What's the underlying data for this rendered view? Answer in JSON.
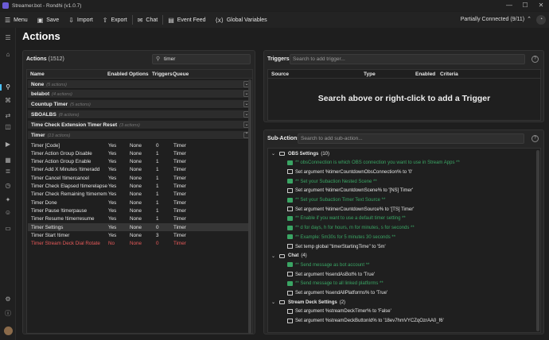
{
  "window": {
    "title": "Streamer.bot - Rondhi (v1.0.7)",
    "minimize": "—",
    "maximize": "☐",
    "close": "✕"
  },
  "menu": {
    "items": [
      {
        "label": "Menu",
        "icon": "hamburger-icon",
        "glyph": "☰"
      },
      {
        "label": "Save",
        "icon": "save-icon",
        "glyph": "▣"
      },
      {
        "label": "Import",
        "icon": "import-icon",
        "glyph": "⇩"
      },
      {
        "label": "Export",
        "icon": "export-icon",
        "glyph": "⇧"
      },
      {
        "label": "Chat",
        "icon": "chat-icon",
        "glyph": "✉"
      },
      {
        "label": "Event Feed",
        "icon": "feed-icon",
        "glyph": "▤"
      },
      {
        "label": "Global Variables",
        "icon": "variables-icon",
        "glyph": "⟨x⟩"
      }
    ],
    "connection": "Partially Connected (9/11)",
    "connection_glyph": "⌃",
    "user_glyph": "◔"
  },
  "rail": {
    "items": [
      {
        "icon": "hamburger-icon",
        "glyph": "☰"
      },
      {
        "icon": "home-icon",
        "glyph": "⌂"
      },
      {
        "icon": "actions-icon",
        "glyph": "⚲",
        "active": true
      },
      {
        "icon": "commands-icon",
        "glyph": "⌘"
      },
      {
        "icon": "servers-icon",
        "glyph": "⇄"
      },
      {
        "icon": "integrations-icon",
        "glyph": "◫"
      },
      {
        "icon": "platform-icon",
        "glyph": "▶"
      },
      {
        "icon": "streamdeck-icon",
        "glyph": "▦"
      },
      {
        "icon": "queue-icon",
        "glyph": "≣"
      },
      {
        "icon": "timers-icon",
        "glyph": "◷"
      },
      {
        "icon": "credits-icon",
        "glyph": "✦"
      },
      {
        "icon": "users-icon",
        "glyph": "☺"
      },
      {
        "icon": "logs-icon",
        "glyph": "▭"
      },
      {
        "icon": "settings-icon",
        "glyph": "⚙"
      },
      {
        "icon": "info-icon",
        "glyph": "ⓘ"
      }
    ]
  },
  "page": {
    "title": "Actions"
  },
  "actions": {
    "label": "Actions",
    "count": "(1512)",
    "search_value": "timer",
    "search_glyph": "⚲",
    "columns": [
      "Name",
      "Enabled",
      "Options",
      "Triggers",
      "Queue"
    ],
    "groups": [
      {
        "name": "None",
        "count": "(5 actions)",
        "chev": "⌄"
      },
      {
        "name": "belabot",
        "count": "(4 actions)",
        "chev": "⌄"
      },
      {
        "name": "Countup Timer",
        "count": "(5 actions)",
        "chev": "⌄"
      },
      {
        "name": "SBOALBS",
        "count": "(8 actions)",
        "chev": "⌄"
      },
      {
        "name": "Time Check Extension Timer Reset",
        "count": "(3 actions)",
        "chev": "⌄"
      },
      {
        "name": "Timer",
        "count": "(13 actions)",
        "chev": "⌃"
      }
    ],
    "rows": [
      {
        "name": "Timer [Code]",
        "enabled": "Yes",
        "options": "None",
        "triggers": "0",
        "queue": "Timer"
      },
      {
        "name": "Timer Action Group Disable",
        "enabled": "Yes",
        "options": "None",
        "triggers": "1",
        "queue": "Timer"
      },
      {
        "name": "Timer Action Group Enable",
        "enabled": "Yes",
        "options": "None",
        "triggers": "1",
        "queue": "Timer"
      },
      {
        "name": "Timer Add X Minutes !timeradd",
        "enabled": "Yes",
        "options": "None",
        "triggers": "1",
        "queue": "Timer"
      },
      {
        "name": "Timer Cancel !timercancel",
        "enabled": "Yes",
        "options": "None",
        "triggers": "1",
        "queue": "Timer"
      },
      {
        "name": "Timer Check Elapsed !timerelapsed",
        "enabled": "Yes",
        "options": "None",
        "triggers": "1",
        "queue": "Timer"
      },
      {
        "name": "Timer Check Remaining !timerremaining",
        "enabled": "Yes",
        "options": "None",
        "triggers": "1",
        "queue": "Timer"
      },
      {
        "name": "Timer Done",
        "enabled": "Yes",
        "options": "None",
        "triggers": "1",
        "queue": "Timer"
      },
      {
        "name": "Timer Pause !timerpause",
        "enabled": "Yes",
        "options": "None",
        "triggers": "1",
        "queue": "Timer"
      },
      {
        "name": "Timer Resume !timerresume",
        "enabled": "Yes",
        "options": "None",
        "triggers": "1",
        "queue": "Timer"
      },
      {
        "name": "Timer Settings",
        "enabled": "Yes",
        "options": "None",
        "triggers": "0",
        "queue": "Timer",
        "selected": true
      },
      {
        "name": "Timer Start !timer",
        "enabled": "Yes",
        "options": "None",
        "triggers": "3",
        "queue": "Timer"
      },
      {
        "name": "Timer Stream Deck Dial Rotate",
        "enabled": "No",
        "options": "None",
        "triggers": "0",
        "queue": "Timer",
        "disabled": true
      }
    ]
  },
  "triggers": {
    "label": "Triggers",
    "search_placeholder": "Search to add trigger...",
    "help": "?",
    "columns": [
      "Source",
      "Type",
      "Enabled",
      "Criteria"
    ],
    "empty": "Search above or right-click to add a Trigger"
  },
  "subactions": {
    "label": "Sub-Actions",
    "search_placeholder": "Search to add sub-action...",
    "help": "?",
    "tree": [
      {
        "type": "group",
        "arrow": "⌄",
        "name": "OBS Settings",
        "count": "(10)",
        "level": 0
      },
      {
        "type": "comment",
        "text": "** obsConnection is which OBS connection you want to use in Stream Apps **",
        "level": 1
      },
      {
        "type": "var",
        "text": "Set argument %timerCountdownObsConnection% to '0'",
        "level": 1
      },
      {
        "type": "comment",
        "text": "** Set your Subaction Nested Scene **",
        "level": 1
      },
      {
        "type": "var",
        "text": "Set argument %timerCountdownScene% to '[NS] Timer'",
        "level": 1
      },
      {
        "type": "comment",
        "text": "** Set your Subaction Timer Text Source **",
        "level": 1
      },
      {
        "type": "var",
        "text": "Set argument %timerCountdownSource% to '[TS] Timer'",
        "level": 1
      },
      {
        "type": "comment",
        "text": "** Enable if you want to use a default timer setting **",
        "level": 1
      },
      {
        "type": "comment",
        "text": "** d for days, h for hours, m for minutes, s for seconds **",
        "level": 1
      },
      {
        "type": "comment",
        "text": "** Example: 5m30s for 5 minutes 30 seconds **",
        "level": 1
      },
      {
        "type": "var",
        "text": "Set temp global \"timerStartingTime\" to '5m'",
        "level": 1
      },
      {
        "type": "group",
        "arrow": "⌄",
        "name": "Chat",
        "count": "(4)",
        "level": 0
      },
      {
        "type": "comment",
        "text": "** Send message as bot account **",
        "level": 1
      },
      {
        "type": "var",
        "text": "Set argument %sendAsBot% to 'True'",
        "level": 1
      },
      {
        "type": "comment",
        "text": "** Send message to all linked platforms **",
        "level": 1
      },
      {
        "type": "var",
        "text": "Set argument %sendAllPlatforms% to 'True'",
        "level": 1
      },
      {
        "type": "group",
        "arrow": "⌄",
        "name": "Stream Deck Settings",
        "count": "(2)",
        "level": 0
      },
      {
        "type": "var",
        "text": "Set argument %streamDeckTimer% to 'False'",
        "level": 1
      },
      {
        "type": "var",
        "text": "Set argument %streamDeckButtonId% to '18ev7hmVYCZqOzrAA0_f6'",
        "level": 1
      }
    ]
  }
}
